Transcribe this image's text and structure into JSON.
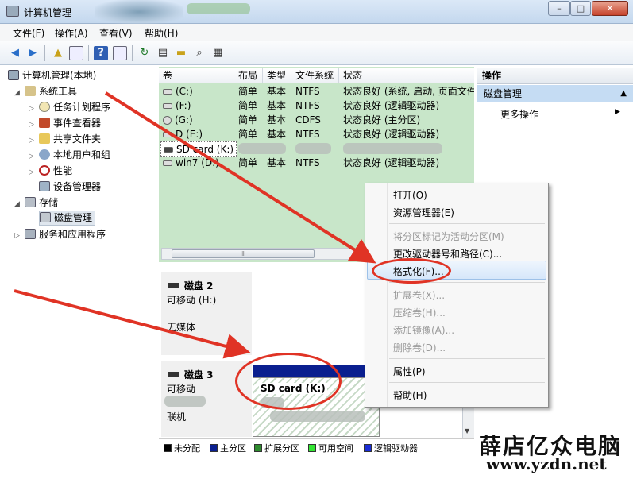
{
  "window": {
    "title": "计算机管理",
    "controls": [
      "–",
      "□",
      "✕"
    ]
  },
  "menubar": [
    "文件(F)",
    "操作(A)",
    "查看(V)",
    "帮助(H)"
  ],
  "tree": {
    "root": "计算机管理(本地)",
    "system_tools": "系统工具",
    "items": [
      "任务计划程序",
      "事件查看器",
      "共享文件夹",
      "本地用户和组",
      "性能",
      "设备管理器"
    ],
    "storage": "存储",
    "disk_mgmt": "磁盘管理",
    "services": "服务和应用程序"
  },
  "volume_list": {
    "columns": [
      "卷",
      "布局",
      "类型",
      "文件系统",
      "状态"
    ],
    "rows": [
      {
        "vol": "(C:)",
        "layout": "简单",
        "type": "基本",
        "fs": "NTFS",
        "status": "状态良好 (系统, 启动, 页面文件"
      },
      {
        "vol": "(F:)",
        "layout": "简单",
        "type": "基本",
        "fs": "NTFS",
        "status": "状态良好 (逻辑驱动器)"
      },
      {
        "vol": "(G:)",
        "layout": "简单",
        "type": "基本",
        "fs": "CDFS",
        "status": "状态良好 (主分区)"
      },
      {
        "vol": "D (E:)",
        "layout": "简单",
        "type": "基本",
        "fs": "NTFS",
        "status": "状态良好 (逻辑驱动器)"
      },
      {
        "vol": "SD card (K:)",
        "layout": "",
        "type": "",
        "fs": "",
        "status": ""
      },
      {
        "vol": "win7 (D:)",
        "layout": "简单",
        "type": "基本",
        "fs": "NTFS",
        "status": "状态良好 (逻辑驱动器)"
      }
    ],
    "scroll_thumb": "III"
  },
  "disks": {
    "disk2": {
      "name": "磁盘 2",
      "type": "可移动 (H:)",
      "media": "无媒体"
    },
    "disk3": {
      "name": "磁盘 3",
      "type": "可移动",
      "status": "联机",
      "partition": "SD card  (K:)"
    }
  },
  "legend": [
    "未分配",
    "主分区",
    "扩展分区",
    "可用空间",
    "逻辑驱动器"
  ],
  "legend_colors": [
    "#000000",
    "#0a1f8f",
    "#2e8b2e",
    "#33e633",
    "#1a2dd6"
  ],
  "actions": {
    "header": "操作",
    "section": "磁盘管理",
    "more": "更多操作"
  },
  "context_menu": {
    "open": "打开(O)",
    "explorer": "资源管理器(E)",
    "mark_active": "将分区标记为活动分区(M)",
    "change_letter": "更改驱动器号和路径(C)...",
    "format": "格式化(F)...",
    "extend": "扩展卷(X)...",
    "shrink": "压缩卷(H)...",
    "mirror": "添加镜像(A)...",
    "delete": "删除卷(D)...",
    "properties": "属性(P)",
    "help": "帮助(H)"
  },
  "watermark": {
    "name": "薛店亿众电脑",
    "url": "www.yzdn.net"
  },
  "colors": {
    "volume_bg": "#c8e6c9",
    "annotation": "#e03325",
    "primary_partition": "#0a1f8f"
  }
}
